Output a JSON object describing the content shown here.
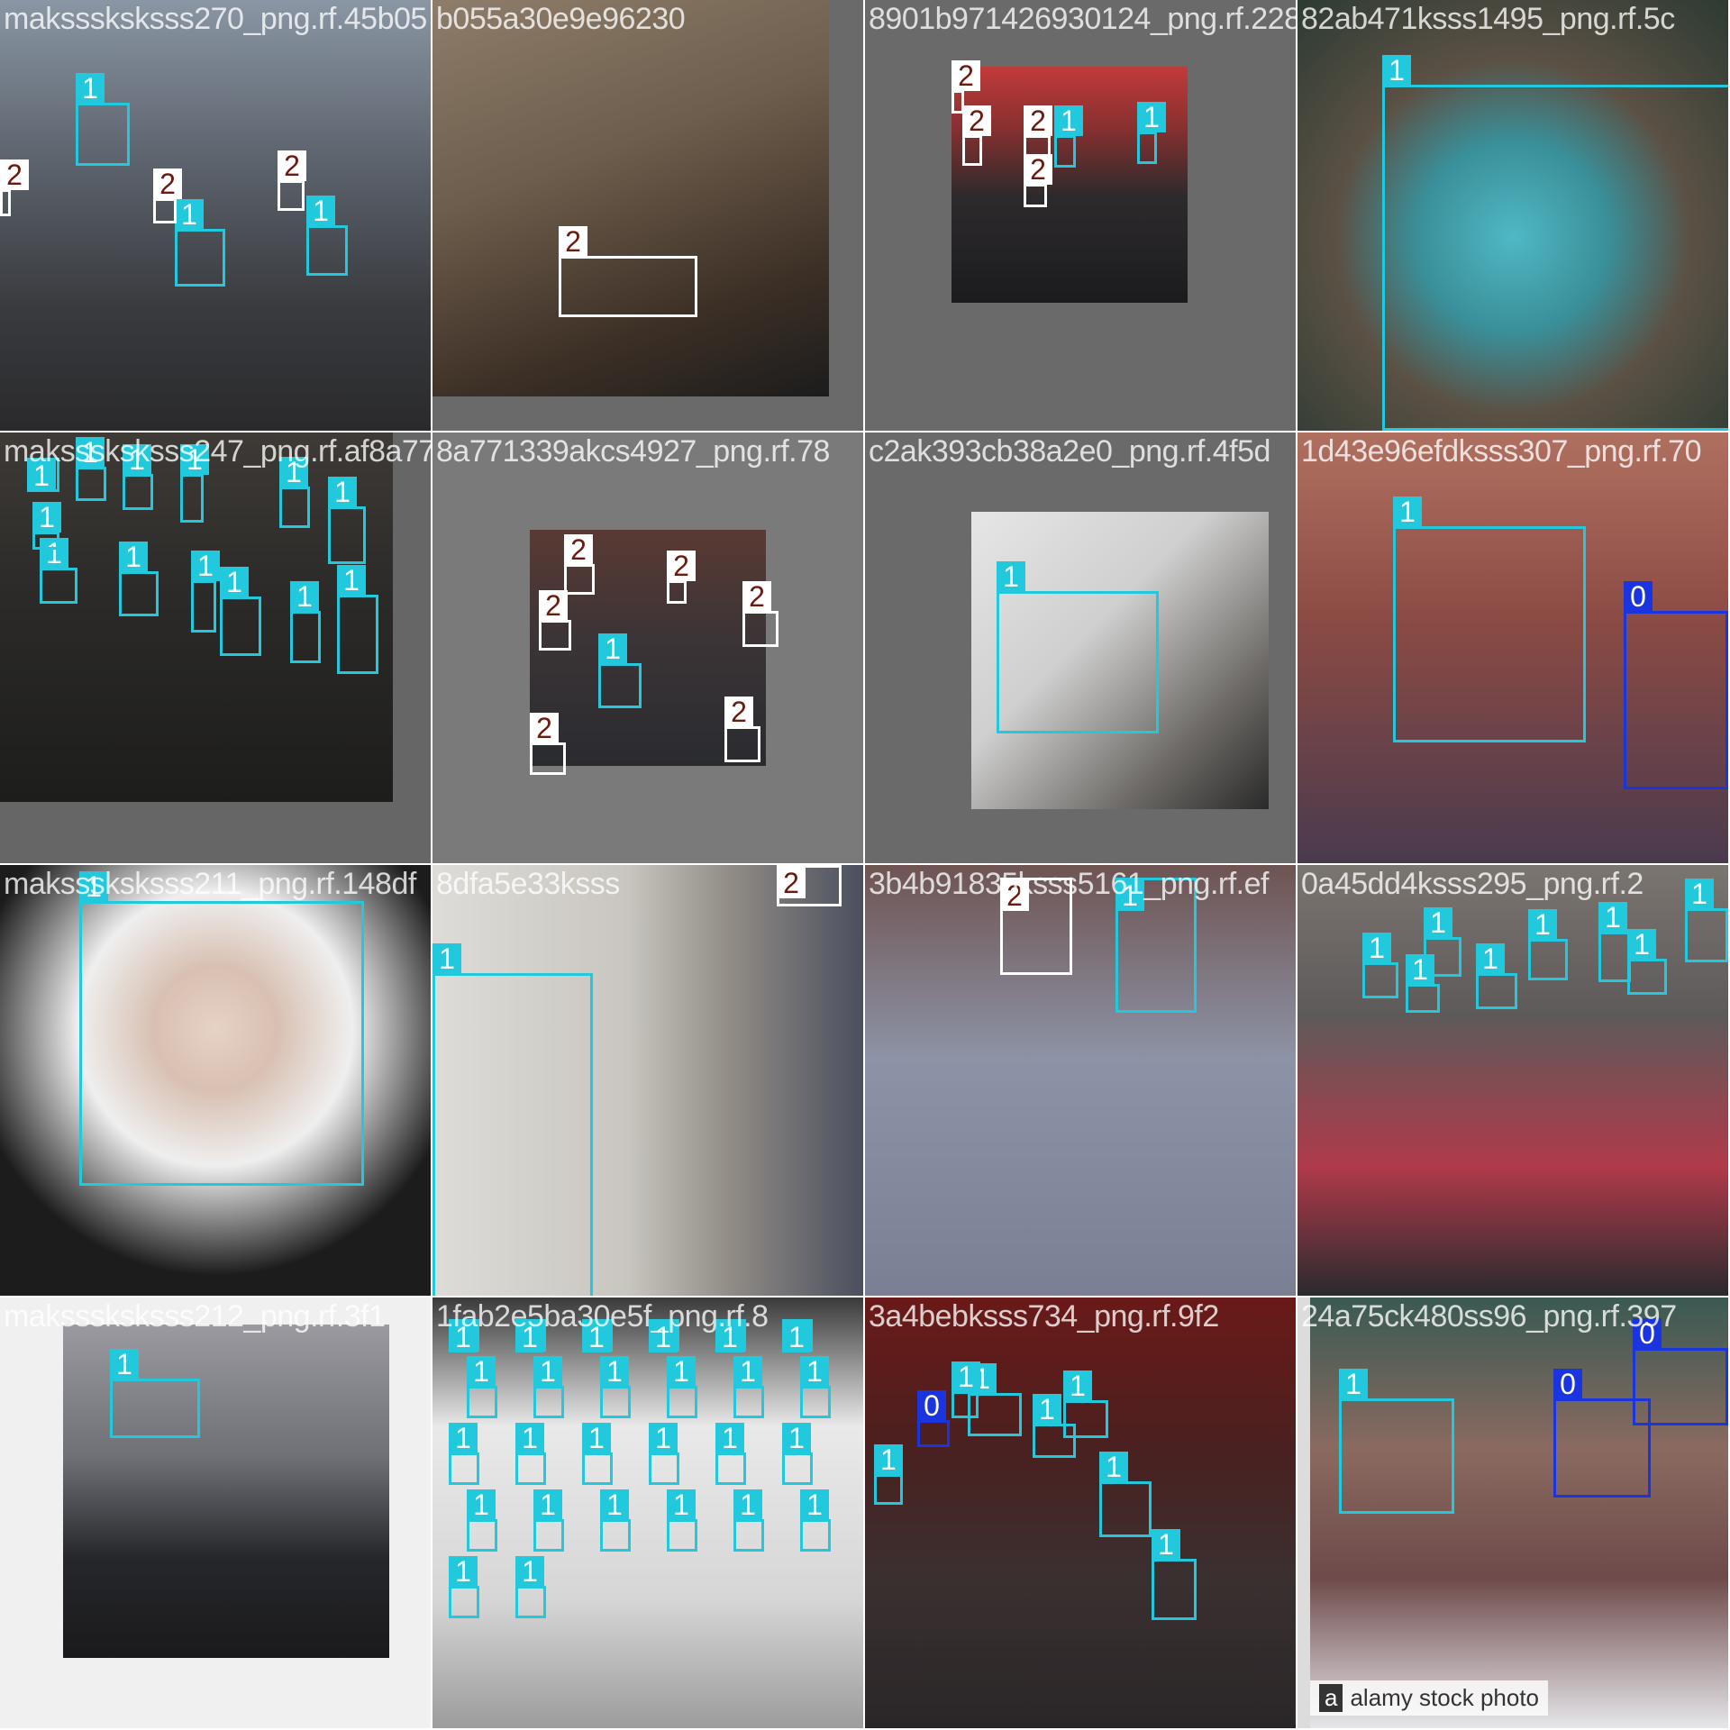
{
  "colors": {
    "class_0": "#1a35e0",
    "class_1": "#22c8dc",
    "class_2_box": "#ffffff",
    "class_2_text": "#6b1a10",
    "grid_gap": "#ffffff"
  },
  "tiles": [
    {
      "filename": "maksssksksss270_png.rf.45b05",
      "bg": "#3c3f44",
      "photo": {
        "bg": "linear-gradient(180deg,#8a96a4 0%,#5f6670 35%,#3a3c40 70%,#2a2a2c 100%)"
      },
      "boxes": [
        {
          "cls": "1",
          "label": "1"
        },
        {
          "cls": "1",
          "label": "1"
        },
        {
          "cls": "1",
          "label": "1"
        },
        {
          "cls": "2",
          "label": "2"
        },
        {
          "cls": "2",
          "label": "2"
        },
        {
          "cls": "2",
          "label": "2"
        }
      ]
    },
    {
      "filename": "b055a30e9e96230",
      "bg": "#6a6a6a",
      "photo": {
        "bg": "linear-gradient(160deg,#8e7d6a 0%,#6d5d4c 40%,#3d3026 75%,#1c1c1c 100%)"
      },
      "boxes": [
        {
          "cls": "2",
          "label": "2"
        }
      ]
    },
    {
      "filename": "8901b971426930124_png.rf.228",
      "bg": "#6a6a6a",
      "photo": {
        "bg": "linear-gradient(180deg,#c23a3a 0%,#8a3030 25%,#2d2a2c 55%,#1b1b1e 100%)"
      },
      "boxes": [
        {
          "cls": "2",
          "label": "2"
        },
        {
          "cls": "2",
          "label": "2"
        },
        {
          "cls": "2",
          "label": "2"
        },
        {
          "cls": "1",
          "label": "1"
        },
        {
          "cls": "1",
          "label": "1"
        },
        {
          "cls": "2",
          "label": "2"
        }
      ]
    },
    {
      "filename": "82ab471ksss1495_png.rf.5c",
      "bg": "#6a7a7c",
      "photo": {
        "bg": "radial-gradient(circle at 50% 55%,#4fb8c4 0%,#3a8f99 30%,#5b5145 55%,#2c3a32 100%)"
      },
      "boxes": [
        {
          "cls": "1",
          "label": "1"
        }
      ]
    },
    {
      "filename": "maksssksksss247_png.rf.af8a77",
      "bg": "#666666",
      "photo": {
        "bg": "linear-gradient(180deg,#3e3a36 0%,#2b2a28 45%,#1d1d1c 100%)"
      },
      "boxes": [
        {
          "cls": "1",
          "label": "1"
        },
        {
          "cls": "1",
          "label": "1"
        },
        {
          "cls": "1",
          "label": "1"
        },
        {
          "cls": "1",
          "label": "1"
        },
        {
          "cls": "1",
          "label": "1"
        },
        {
          "cls": "1",
          "label": "1"
        },
        {
          "cls": "1",
          "label": "1"
        },
        {
          "cls": "1",
          "label": "1"
        },
        {
          "cls": "1",
          "label": "1"
        },
        {
          "cls": "1",
          "label": "1"
        },
        {
          "cls": "1",
          "label": "1"
        },
        {
          "cls": "1",
          "label": "1"
        },
        {
          "cls": "1",
          "label": "1"
        }
      ]
    },
    {
      "filename": "8a771339akcs4927_png.rf.78",
      "bg": "#7a7a7a",
      "photo": {
        "bg": "linear-gradient(180deg,#5a3a34 0%,#3c3436 45%,#2a2b30 100%)"
      },
      "boxes": [
        {
          "cls": "2",
          "label": "2"
        },
        {
          "cls": "2",
          "label": "2"
        },
        {
          "cls": "2",
          "label": "2"
        },
        {
          "cls": "2",
          "label": "2"
        },
        {
          "cls": "1",
          "label": "1"
        },
        {
          "cls": "2",
          "label": "2"
        },
        {
          "cls": "2",
          "label": "2"
        }
      ]
    },
    {
      "filename": "c2ak393cb38a2e0_png.rf.4f5d",
      "bg": "#6a6a6a",
      "photo": {
        "bg": "linear-gradient(135deg,#e6e6e6 0%,#cfcfcf 40%,#6d6a66 75%,#2a2a2a 100%)"
      },
      "boxes": [
        {
          "cls": "1",
          "label": "1"
        }
      ]
    },
    {
      "filename": "1d43e96efdksss307_png.rf.70",
      "bg": "#8a5b50",
      "photo": {
        "bg": "linear-gradient(180deg,#b07060 0%,#8a4a44 45%,#4a3a4e 100%)"
      },
      "boxes": [
        {
          "cls": "1",
          "label": "1"
        },
        {
          "cls": "0",
          "label": "0"
        }
      ]
    },
    {
      "filename": "maksssksksss211_png.rf.148df",
      "bg": "#f4f4f4",
      "photo": {
        "bg": "radial-gradient(circle at 50% 38%,#e7d2c6 0%,#d8c0b2 18%,#efefef 40%,#1c1c1c 72%)"
      },
      "boxes": [
        {
          "cls": "1",
          "label": "1"
        }
      ]
    },
    {
      "filename": "8dfa5e33ksss",
      "bg": "#dcdcdc",
      "photo": {
        "bg": "linear-gradient(90deg,#dedcd8 0%,#c9c6c0 45%,#8f8a84 70%,#4a4f5e 100%)"
      },
      "boxes": [
        {
          "cls": "1",
          "label": "1"
        },
        {
          "cls": "2",
          "label": "2"
        }
      ]
    },
    {
      "filename": "3b4b91835ksss5161_png.rf.ef",
      "bg": "#7a5e58",
      "photo": {
        "bg": "linear-gradient(180deg,#6e5452 0%,#8d93a6 45%,#7b7f94 100%)"
      },
      "boxes": [
        {
          "cls": "2",
          "label": "2"
        },
        {
          "cls": "1",
          "label": "1"
        }
      ]
    },
    {
      "filename": "0a45dd4ksss295_png.rf.2",
      "bg": "#6b5f5c",
      "photo": {
        "bg": "linear-gradient(180deg,#7b7570 0%,#5e5a5a 35%,#b03a4a 70%,#2a2a2e 100%)"
      },
      "boxes": [
        {
          "cls": "1",
          "label": "1"
        },
        {
          "cls": "1",
          "label": "1"
        },
        {
          "cls": "1",
          "label": "1"
        },
        {
          "cls": "1",
          "label": "1"
        },
        {
          "cls": "1",
          "label": "1"
        },
        {
          "cls": "1",
          "label": "1"
        },
        {
          "cls": "1",
          "label": "1"
        },
        {
          "cls": "1",
          "label": "1"
        }
      ]
    },
    {
      "filename": "maksssksksss212_png.rf.3f1",
      "bg": "#f0f0f0",
      "photo": {
        "bg": "linear-gradient(180deg,#9a9aa0 0%,#6e7076 40%,#26272b 70%,#1a1a1c 100%)"
      },
      "boxes": [
        {
          "cls": "1",
          "label": "1"
        }
      ]
    },
    {
      "filename": "1fab2e5ba30e5f_png.rf.8",
      "bg": "#e8e8e8",
      "photo": {
        "bg": "linear-gradient(180deg,#3a3a3a 0%,#e9e9e9 30%,#d6d6d6 70%,#9c9c9c 100%)"
      },
      "boxes": [
        {
          "cls": "1",
          "label": "1"
        },
        {
          "cls": "1",
          "label": "1"
        },
        {
          "cls": "1",
          "label": "1"
        },
        {
          "cls": "1",
          "label": "1"
        },
        {
          "cls": "1",
          "label": "1"
        },
        {
          "cls": "1",
          "label": "1"
        },
        {
          "cls": "1",
          "label": "1"
        },
        {
          "cls": "1",
          "label": "1"
        },
        {
          "cls": "1",
          "label": "1"
        },
        {
          "cls": "1",
          "label": "1"
        },
        {
          "cls": "1",
          "label": "1"
        },
        {
          "cls": "1",
          "label": "1"
        },
        {
          "cls": "1",
          "label": "1"
        },
        {
          "cls": "1",
          "label": "1"
        },
        {
          "cls": "1",
          "label": "1"
        },
        {
          "cls": "1",
          "label": "1"
        },
        {
          "cls": "1",
          "label": "1"
        },
        {
          "cls": "1",
          "label": "1"
        },
        {
          "cls": "1",
          "label": "1"
        },
        {
          "cls": "1",
          "label": "1"
        },
        {
          "cls": "1",
          "label": "1"
        },
        {
          "cls": "1",
          "label": "1"
        },
        {
          "cls": "1",
          "label": "1"
        },
        {
          "cls": "1",
          "label": "1"
        },
        {
          "cls": "1",
          "label": "1"
        },
        {
          "cls": "1",
          "label": "1"
        }
      ]
    },
    {
      "filename": "3a4bebksss734_png.rf.9f2",
      "bg": "#4a1a1a",
      "photo": {
        "bg": "linear-gradient(180deg,#6a1a18 0%,#4a2020 35%,#3a3030 65%,#2a2628 100%)"
      },
      "boxes": [
        {
          "cls": "0",
          "label": "0"
        },
        {
          "cls": "1",
          "label": "1"
        },
        {
          "cls": "1",
          "label": "1"
        },
        {
          "cls": "1",
          "label": "1"
        },
        {
          "cls": "1",
          "label": "1"
        },
        {
          "cls": "1",
          "label": "1"
        },
        {
          "cls": "1",
          "label": "1"
        },
        {
          "cls": "1",
          "label": "1"
        },
        {
          "cls": "1",
          "label": "1"
        }
      ]
    },
    {
      "filename": "24a75ck480ss96_png.rf.397",
      "bg": "#dcdcdc",
      "photo": {
        "bg": "linear-gradient(180deg,#3a5a52 0%,#8a6a60 35%,#6e4a4a 65%,#e6e6ea 100%)"
      },
      "watermark": "alamy stock photo",
      "watermark_logo": "a",
      "boxes": [
        {
          "cls": "1",
          "label": "1"
        },
        {
          "cls": "0",
          "label": "0"
        },
        {
          "cls": "0",
          "label": "0"
        }
      ]
    }
  ]
}
